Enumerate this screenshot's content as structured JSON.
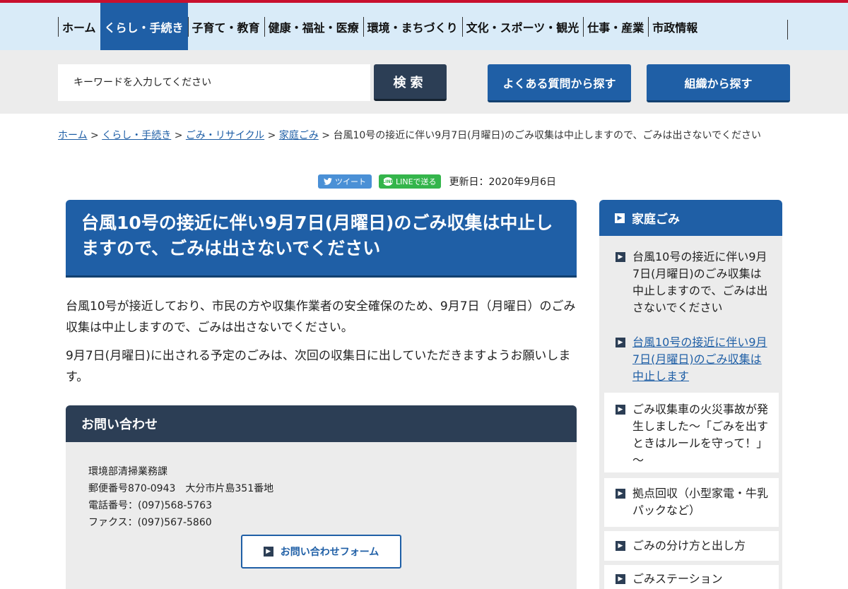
{
  "nav": {
    "items": [
      {
        "label": "ホーム",
        "active": false
      },
      {
        "label": "くらし・手続き",
        "active": true
      },
      {
        "label": "子育て・教育",
        "active": false
      },
      {
        "label": "健康・福祉・医療",
        "active": false
      },
      {
        "label": "環境・まちづくり",
        "active": false
      },
      {
        "label": "文化・スポーツ・観光",
        "active": false
      },
      {
        "label": "仕事・産業",
        "active": false
      },
      {
        "label": "市政情報",
        "active": false
      }
    ]
  },
  "search": {
    "placeholder": "キーワードを入力してください",
    "button": "検索",
    "faq_button": "よくある質問から探す",
    "org_button": "組織から探す"
  },
  "breadcrumb": {
    "links": [
      "ホーム",
      "くらし・手続き",
      "ごみ・リサイクル",
      "家庭ごみ"
    ],
    "separator": ">",
    "current": "台風10号の接近に伴い9月7日(月曜日)のごみ収集は中止しますので、ごみは出さないでください"
  },
  "share": {
    "tweet": "ツイート",
    "line": "LINEで送る",
    "line_icon": "LINE",
    "updated": "更新日：2020年9月6日"
  },
  "article": {
    "title": "台風10号の接近に伴い9月7日(月曜日)のごみ収集は中止しますので、ごみは出さないでください",
    "paragraphs": [
      "台風10号が接近しており、市民の方や収集作業者の安全確保のため、9月7日（月曜日）のごみ収集は中止しますので、ごみは出さないでください。",
      "9月7日(月曜日)に出される予定のごみは、次回の収集日に出していただきますようお願いします。"
    ]
  },
  "contact": {
    "heading": "お問い合わせ",
    "department": "環境部清掃業務課",
    "address": "郵便番号870-0943　大分市片島351番地",
    "phone": "電話番号：(097)568-5763",
    "fax": "ファクス：(097)567-5860",
    "form_button": "お問い合わせフォーム"
  },
  "sidebar": {
    "heading": "家庭ごみ",
    "items": [
      {
        "label": "台風10号の接近に伴い9月7日(月曜日)のごみ収集は中止しますので、ごみは出さないでください"
      },
      {
        "label": "台風10号の接近に伴い9月7日(月曜日)のごみ収集は中止します"
      },
      {
        "label": "ごみ収集車の火災事故が発生しました～「ごみを出すときはルールを守って！」～"
      },
      {
        "label": "拠点回収（小型家電・牛乳パックなど）"
      },
      {
        "label": "ごみの分け方と出し方"
      },
      {
        "label": "ごみステーション"
      }
    ]
  },
  "icons": {
    "arrow": "chevron-right-square-icon",
    "twitter": "twitter-bird-icon",
    "line": "line-logo-icon"
  },
  "colors": {
    "brand_blue": "#1f5fa6",
    "dark_navy": "#2c3e55",
    "nav_bg": "#d9ebf8",
    "top_red": "#c8102e",
    "line_green": "#34b54b",
    "twitter_blue": "#4a90d6"
  }
}
